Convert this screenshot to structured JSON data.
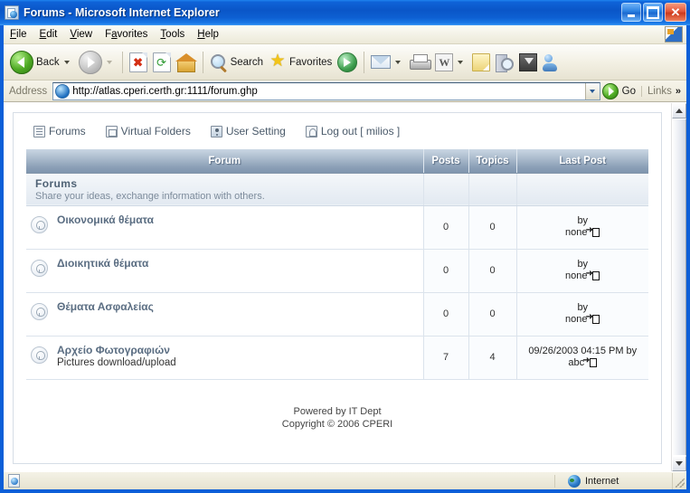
{
  "window": {
    "title": "Forums - Microsoft Internet Explorer",
    "icon": "ie-document-icon",
    "buttons": {
      "minimize": "minimize-button",
      "maximize": "maximize-button",
      "close_glyph": "✕"
    }
  },
  "menubar": {
    "items": [
      {
        "label": "File",
        "accel": "F"
      },
      {
        "label": "Edit",
        "accel": "E"
      },
      {
        "label": "View",
        "accel": "V"
      },
      {
        "label": "Favorites",
        "accel": "a"
      },
      {
        "label": "Tools",
        "accel": "T"
      },
      {
        "label": "Help",
        "accel": "H"
      }
    ]
  },
  "toolbar": {
    "back_label": "Back",
    "forward_label": "",
    "search_label": "Search",
    "favorites_label": "Favorites",
    "word_glyph": "W"
  },
  "address": {
    "label": "Address",
    "value": "http://atlas.cperi.certh.gr:1111/forum.ghp",
    "placeholder": "http://",
    "go_label": "Go",
    "links_label": "Links",
    "links_chevron": "»"
  },
  "page": {
    "nav": [
      {
        "label": "Forums",
        "icon": "list-icon"
      },
      {
        "label": "Virtual Folders",
        "icon": "folder-icon"
      },
      {
        "label": "User Setting",
        "icon": "user-icon"
      },
      {
        "label": "Log out [ milios ]",
        "icon": "logout-icon"
      }
    ],
    "table": {
      "headers": [
        "Forum",
        "Posts",
        "Topics",
        "Last Post"
      ],
      "category": {
        "title": "Forums",
        "subtitle": "Share your ideas, exchange information with others."
      },
      "rows": [
        {
          "title": "Οικονομικά θέματα",
          "description": "",
          "posts": "0",
          "topics": "0",
          "last_post_line1": "by",
          "last_post_line2": "none"
        },
        {
          "title": "Διοικητικά θέματα",
          "description": "",
          "posts": "0",
          "topics": "0",
          "last_post_line1": "by",
          "last_post_line2": "none"
        },
        {
          "title": "Θέματα Ασφαλείας",
          "description": "",
          "posts": "0",
          "topics": "0",
          "last_post_line1": "by",
          "last_post_line2": "none"
        },
        {
          "title": "Αρχείο Φωτογραφιών",
          "description": "Pictures download/upload",
          "posts": "7",
          "topics": "4",
          "last_post_line1": "09/26/2003 04:15 PM by",
          "last_post_line2": "abc"
        }
      ]
    },
    "footer": {
      "line1": "Powered by IT Dept",
      "line2": "Copyright © 2006 CPERI"
    }
  },
  "statusbar": {
    "zone": "Internet"
  },
  "colors": {
    "titlebar_blue": "#0a56c8",
    "table_header": "#8ca0b7",
    "category_bg": "#e2e9f1",
    "forum_title": "#5a6d82",
    "link_nav": "#4a5a6a"
  }
}
